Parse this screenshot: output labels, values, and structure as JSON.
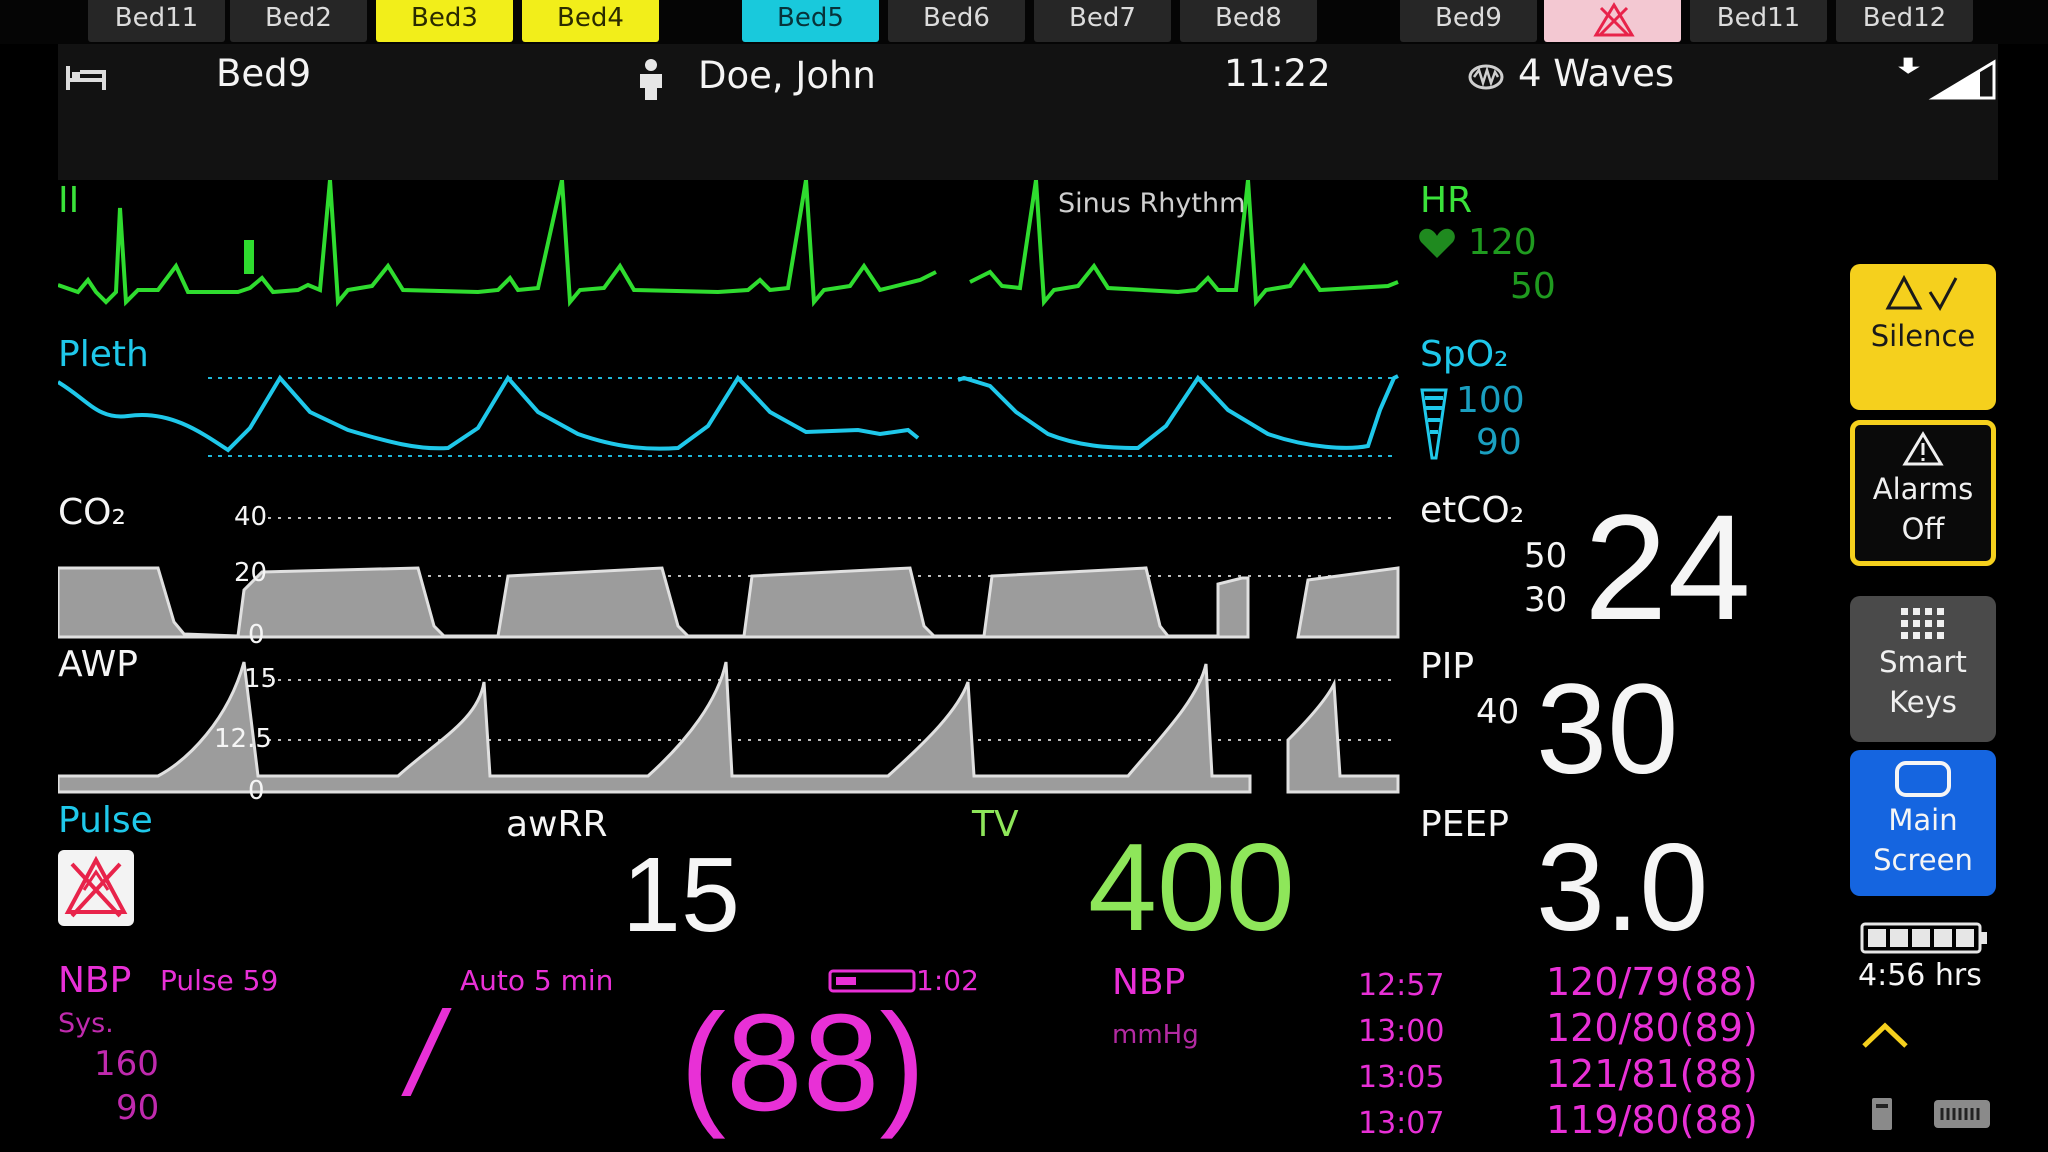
{
  "bed_tabs": [
    "Bed11",
    "Bed2",
    "Bed3",
    "Bed4",
    "Bed5",
    "Bed6",
    "Bed7",
    "Bed8",
    "Bed9",
    "Bed11",
    "Bed12"
  ],
  "header": {
    "bed": "Bed9",
    "patient": "Doe, John",
    "time": "11:22",
    "waves": "4  Waves"
  },
  "ecg": {
    "lead": "II",
    "rhythm": "Sinus Rhythm",
    "hr_label": "HR",
    "hr_high": "120",
    "hr_low": "50"
  },
  "pleth": {
    "label": "Pleth",
    "spo2_label": "SpO₂",
    "spo2_high": "100",
    "spo2_low": "90"
  },
  "co2": {
    "label": "CO₂",
    "scale_top": "40",
    "scale_mid": "20",
    "scale_zero": "0",
    "etco2_label": "etCO₂",
    "etco2_high": "50",
    "etco2_low": "30",
    "etco2_value": "24"
  },
  "awp": {
    "label": "AWP",
    "scale_top": "15",
    "scale_mid": "12.5",
    "scale_zero": "0",
    "pip_label": "PIP",
    "pip_limit": "40",
    "pip_value": "30",
    "peep_label": "PEEP",
    "peep_value": "3.0"
  },
  "params": {
    "pulse_label": "Pulse",
    "awrr_label": "awRR",
    "awrr_value": "15",
    "tv_label": "TV",
    "tv_value": "400"
  },
  "nbp": {
    "label": "NBP",
    "pulse": "Pulse 59",
    "sys_label": "Sys.",
    "sys_high": "160",
    "sys_low": "90",
    "mode": "Auto  5 min",
    "timer": "1:02",
    "current_slash": "/",
    "current_mean": "(88)",
    "list_label": "NBP",
    "list_unit": "mmHg",
    "history": [
      {
        "time": "12:57",
        "value": "120/79(88)"
      },
      {
        "time": "13:00",
        "value": "120/80(89)"
      },
      {
        "time": "13:05",
        "value": "121/81(88)"
      },
      {
        "time": "13:07",
        "value": "119/80(88)"
      }
    ]
  },
  "softkeys": {
    "silence": "Silence",
    "alarms_off_1": "Alarms",
    "alarms_off_2": "Off",
    "smart_keys_1": "Smart",
    "smart_keys_2": "Keys",
    "main_screen_1": "Main",
    "main_screen_2": "Screen"
  },
  "status": {
    "battery_time": "4:56  hrs",
    "battery_fill_fraction": 1.0
  },
  "colors": {
    "ecg": "#3ae23a",
    "pleth": "#1fc8ea",
    "nbp": "#e830d6",
    "tv": "#8ee65a",
    "silence_key": "#f5d01d",
    "main_screen_key": "#1565e0"
  },
  "icons": {
    "bed_status": "bed-icon",
    "patient": "person-icon",
    "waves": "waves-icon",
    "signal": "signal-icon",
    "alarm_paused": "alarm-off-icon",
    "battery": "battery-icon"
  }
}
